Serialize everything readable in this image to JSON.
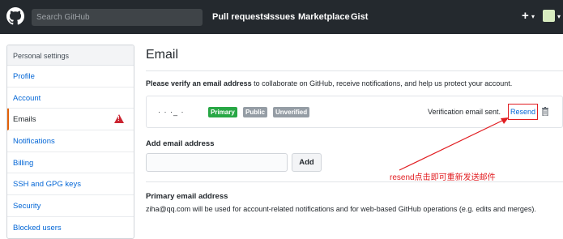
{
  "header": {
    "search_placeholder": "Search GitHub",
    "nav": [
      "Pull requests",
      "Issues",
      "Marketplace",
      "Gist"
    ],
    "plus": "+"
  },
  "sidebar": {
    "heading": "Personal settings",
    "items": [
      {
        "label": "Profile"
      },
      {
        "label": "Account"
      },
      {
        "label": "Emails",
        "active": true,
        "icon": "alert-icon"
      },
      {
        "label": "Notifications"
      },
      {
        "label": "Billing"
      },
      {
        "label": "SSH and GPG keys"
      },
      {
        "label": "Security"
      },
      {
        "label": "Blocked users"
      }
    ]
  },
  "main": {
    "title": "Email",
    "verify_bold": "Please verify an email address",
    "verify_rest": " to collaborate on GitHub, receive notifications, and help us protect your account.",
    "email": {
      "address": "· ·  ·_ ·",
      "badges": [
        {
          "label": "Primary",
          "color": "#28a745"
        },
        {
          "label": "Public",
          "color": "#959da5"
        },
        {
          "label": "Unverified",
          "color": "#959da5"
        }
      ],
      "status": "Verification email sent.",
      "resend": "Resend"
    },
    "add_label": "Add email address",
    "add_button": "Add",
    "annotation": "resend点击即可重新发送邮件",
    "primary_label": "Primary email address",
    "primary_text": "ziha@qq.com will be used for account-related notifications and for web-based GitHub operations (e.g. edits and merges)."
  },
  "colors": {
    "topbar": "#24292e",
    "link": "#0366d6",
    "annotation": "#e11d21"
  }
}
